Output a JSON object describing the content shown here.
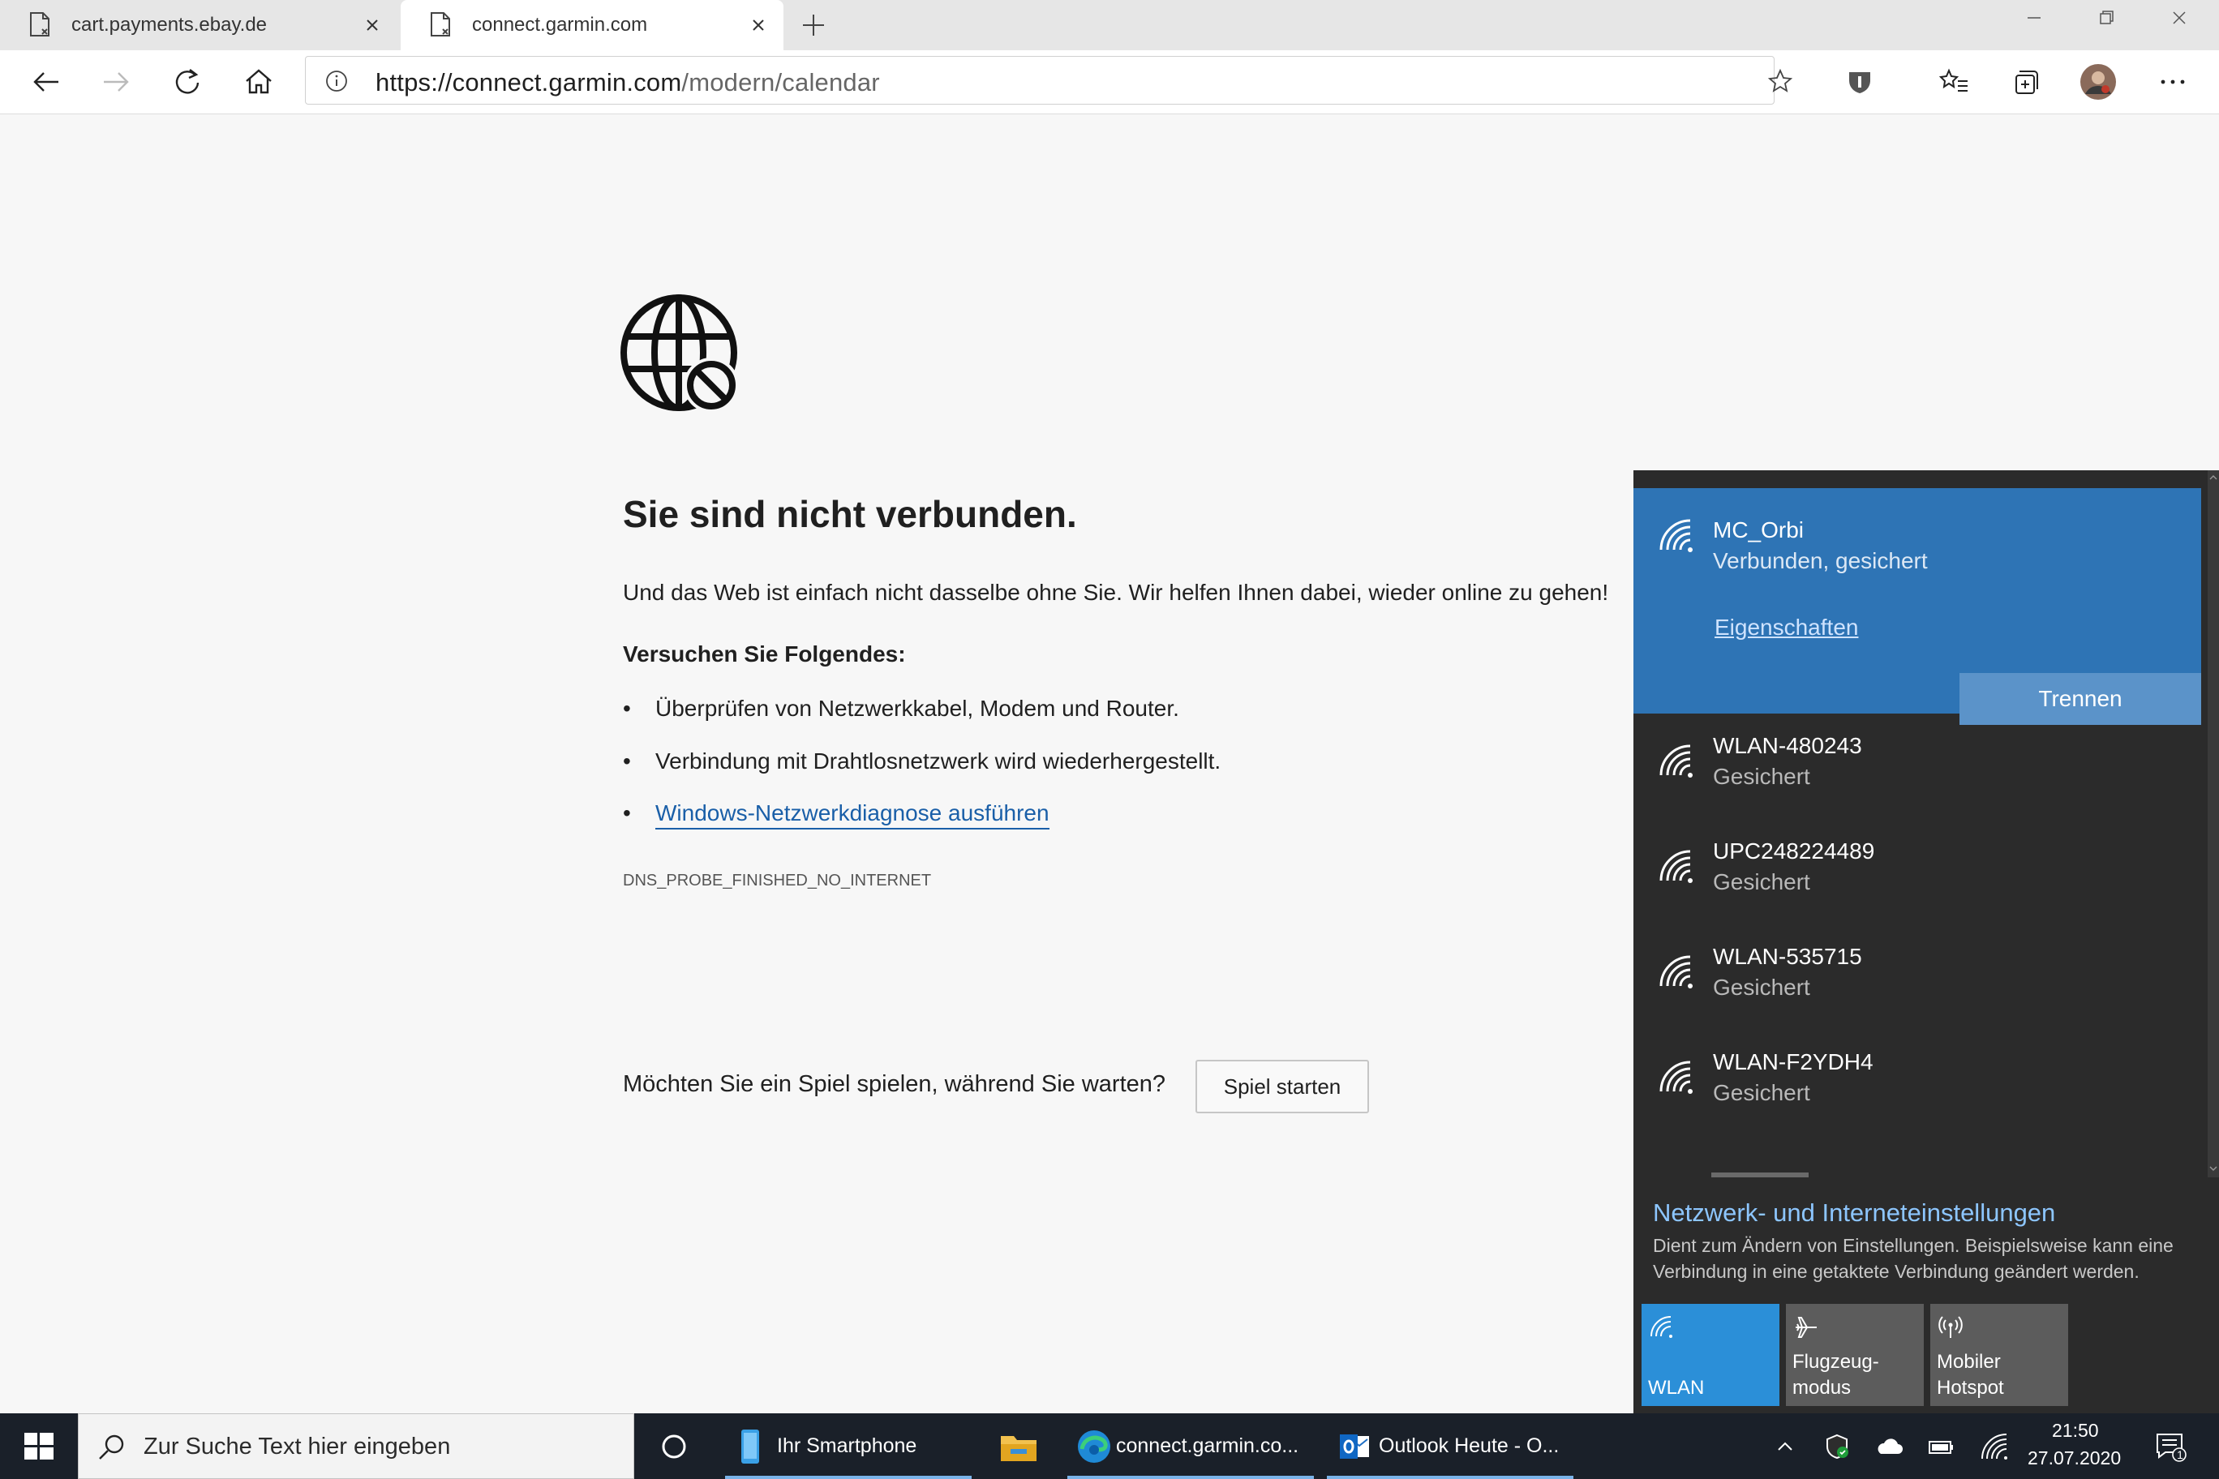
{
  "browser": {
    "tabs": [
      {
        "label": "cart.payments.ebay.de"
      },
      {
        "label": "connect.garmin.com"
      }
    ],
    "url": {
      "host": "https://connect.garmin.com",
      "path": "/modern/calendar"
    }
  },
  "error_page": {
    "title": "Sie sind nicht verbunden.",
    "intro": "Und das Web ist einfach nicht dasselbe ohne Sie. Wir helfen Ihnen dabei, wieder online zu gehen!",
    "try_heading": "Versuchen Sie Folgendes:",
    "bullet_char": "•",
    "suggestions": [
      "Überprüfen von Netzwerkkabel, Modem und Router.",
      "Verbindung mit Drahtlosnetzwerk wird wiederhergestellt.",
      "Windows-Netzwerkdiagnose ausführen"
    ],
    "error_code": "DNS_PROBE_FINISHED_NO_INTERNET",
    "game_prompt": "Möchten Sie ein Spiel spielen, während Sie warten?",
    "game_button": "Spiel starten"
  },
  "network_flyout": {
    "connected": {
      "ssid": "MC_Orbi",
      "status": "Verbunden, gesichert",
      "properties_link": "Eigenschaften",
      "disconnect_button": "Trennen"
    },
    "networks": [
      {
        "ssid": "WLAN-480243",
        "status": "Gesichert"
      },
      {
        "ssid": "UPC248224489",
        "status": "Gesichert"
      },
      {
        "ssid": "WLAN-535715",
        "status": "Gesichert"
      },
      {
        "ssid": "WLAN-F2YDH4",
        "status": "Gesichert"
      }
    ],
    "settings_link": "Netzwerk- und Interneteinstellungen",
    "settings_desc": "Dient zum Ändern von Einstellungen. Beispielsweise kann eine Verbindung in eine getaktete Verbindung geändert werden.",
    "quick_actions": [
      {
        "label": "WLAN",
        "active": true
      },
      {
        "label": "Flugzeug-\nmodus",
        "active": false
      },
      {
        "label": "Mobiler\nHotspot",
        "active": false
      }
    ]
  },
  "taskbar": {
    "search_placeholder": "Zur Suche Text hier eingeben",
    "apps": [
      {
        "label": "Ihr Smartphone"
      },
      {
        "label": ""
      },
      {
        "label": "connect.garmin.co..."
      },
      {
        "label": "Outlook Heute - O..."
      }
    ],
    "time": "21:50",
    "date": "27.07.2020",
    "notification_count": "1"
  }
}
